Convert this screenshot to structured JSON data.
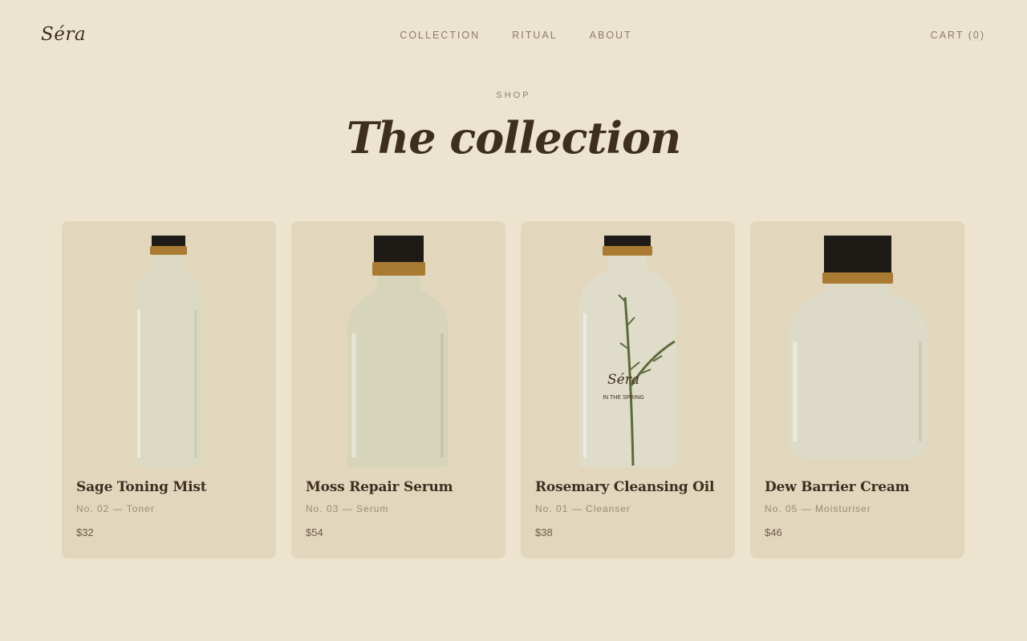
{
  "brand": {
    "logo": "Séra"
  },
  "nav": {
    "links": [
      "COLLECTION",
      "RITUAL",
      "ABOUT"
    ],
    "cart": "CART (0)"
  },
  "hero": {
    "eyebrow": "SHOP",
    "title": "The collection"
  },
  "products": [
    {
      "name": "Sage Toning Mist",
      "meta": "No. 02 — Toner",
      "price": "$32"
    },
    {
      "name": "Moss Repair Serum",
      "meta": "No. 03 — Serum",
      "price": "$54"
    },
    {
      "name": "Rosemary Cleansing Oil",
      "meta": "No. 01 — Cleanser",
      "price": "$38",
      "label_brand": "Séra",
      "label_line": "IN THE SPRING"
    },
    {
      "name": "Dew Barrier Cream",
      "meta": "No. 05 — Moisturiser",
      "price": "$46"
    }
  ],
  "colors": {
    "background": "#ede4d0",
    "card": "#e2d6bd",
    "text_dark": "#3e2e20",
    "text_muted": "#8a7b68",
    "cap_black": "#1e1b16",
    "cap_gold": "#a87a32",
    "glass": "#dcd9c3"
  }
}
